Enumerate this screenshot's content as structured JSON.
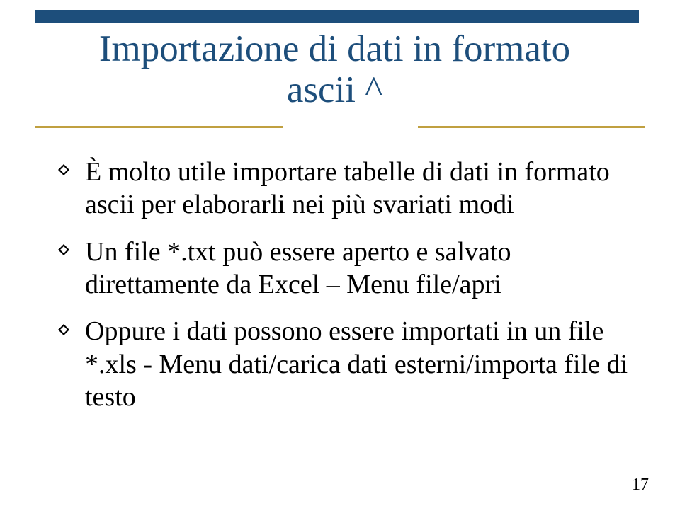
{
  "title_line1": "Importazione di dati in formato",
  "title_line2": "ascii ^",
  "bullets": [
    "È molto utile importare tabelle di dati in formato ascii per elaborarli nei più svariati modi",
    "Un file *.txt può essere aperto e salvato direttamente da Excel – Menu file/apri",
    "Oppure i dati possono essere importati in un file *.xls - Menu dati/carica dati esterni/importa file di testo"
  ],
  "page_number": "17"
}
